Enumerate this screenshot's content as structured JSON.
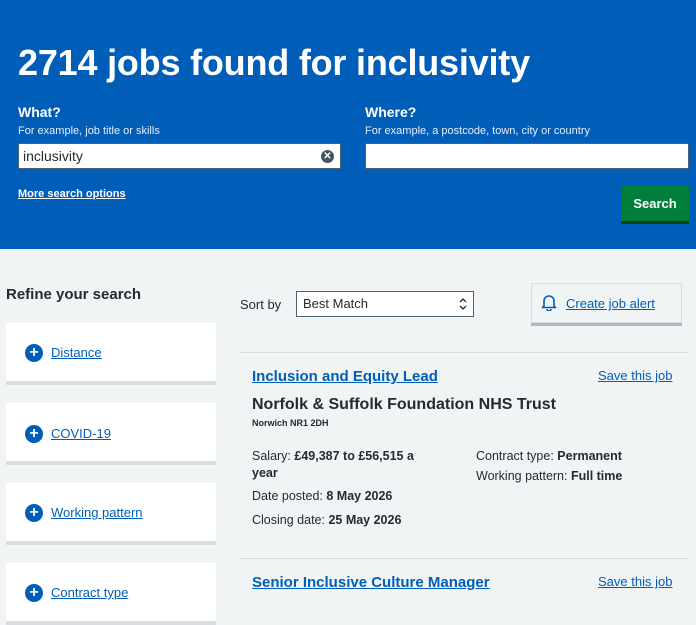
{
  "header": {
    "title": "2714 jobs found for inclusivity"
  },
  "search": {
    "what_label": "What?",
    "what_hint": "For example, job title or skills",
    "what_value": "inclusivity",
    "where_label": "Where?",
    "where_hint": "For example, a postcode, town, city or country",
    "where_value": "",
    "more_options_link": "More search options",
    "search_button": "Search"
  },
  "refine": {
    "title": "Refine your search",
    "filters": [
      {
        "label": "Distance"
      },
      {
        "label": "COVID-19"
      },
      {
        "label": "Working pattern"
      },
      {
        "label": "Contract type"
      }
    ]
  },
  "sort": {
    "label": "Sort by",
    "selected": "Best Match"
  },
  "alert": {
    "label": "Create job alert"
  },
  "jobs": [
    {
      "title": "Inclusion and Equity Lead",
      "save_label": "Save this job",
      "employer": "Norfolk & Suffolk Foundation NHS Trust",
      "location": "Norwich NR1 2DH",
      "salary_label": "Salary: ",
      "salary_value": "£49,387 to £56,515 a",
      "salary_value_2": "year",
      "date_posted_label": "Date posted: ",
      "date_posted": "8 May 2026",
      "closing_label": "Closing date: ",
      "closing_date": "25 May 2026",
      "contract_label": "Contract type: ",
      "contract_type": "Permanent",
      "pattern_label": "Working pattern: ",
      "working_pattern": "Full time"
    },
    {
      "title": "Senior Inclusive Culture Manager",
      "save_label": "Save this job"
    }
  ],
  "colors": {
    "banner": "#005eb8",
    "link": "#005eb8",
    "search_button": "#007f3b",
    "page_background": "#f0f4f5"
  }
}
